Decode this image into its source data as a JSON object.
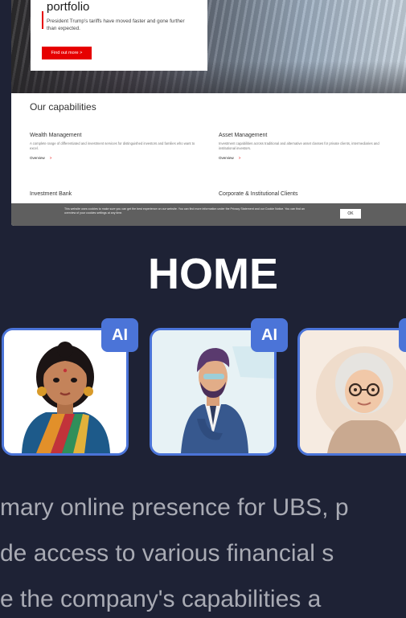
{
  "website": {
    "hero_title": "portfolio",
    "hero_text": "President Trump's tariffs have moved faster and gone further than expected.",
    "hero_button": "Find out more  >",
    "capabilities_title": "Our capabilities",
    "capabilities": [
      {
        "name": "Wealth Management",
        "desc": "A complete range of differentiated and investment services for distinguished investors and families who want to excel.",
        "link": "Overview"
      },
      {
        "name": "Asset Management",
        "desc": "Investment capabilities across traditional and alternative asset classes for private clients, intermediaries and institutional investors.",
        "link": "Overview"
      }
    ],
    "capabilities_row2": [
      "Investment Bank",
      "Corporate & Institutional Clients"
    ],
    "cookie_text": "This website uses cookies to make sure you can get the best experience on our website. You can find more information under the Privacy Statement and our Cookie Notice. You can find an overview of your cookies settings at any time.",
    "cookie_button": "OK"
  },
  "page": {
    "title": "HOME",
    "badge_label": "AI",
    "body_lines": [
      "mary online presence for UBS, p",
      "de access to various financial s",
      "e the company's capabilities a"
    ]
  },
  "avatars": [
    {
      "icon": "woman-in-saree-avatar-icon"
    },
    {
      "icon": "man-in-suit-avatar-icon"
    },
    {
      "icon": "elderly-woman-avatar-icon"
    }
  ],
  "colors": {
    "background": "#1e2235",
    "accent": "#4b74d8",
    "brand_red": "#e60000",
    "body_text": "#a9abb4"
  }
}
